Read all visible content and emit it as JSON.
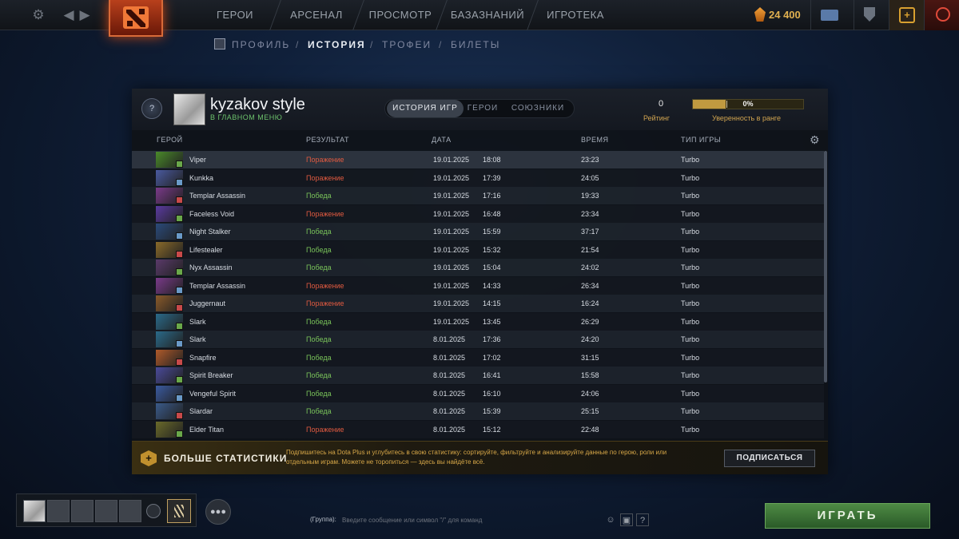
{
  "topbar": {
    "nav": [
      "ГЕРОИ",
      "АРСЕНАЛ",
      "ПРОСМОТР",
      "БАЗАЗНАНИЙ",
      "ИГРОТЕКА"
    ],
    "currency": "24 400"
  },
  "subnav": {
    "items": [
      "ПРОФИЛЬ",
      "ИСТОРИЯ",
      "ТРОФЕИ",
      "БИЛЕТЫ"
    ],
    "active": "ИСТОРИЯ"
  },
  "profile": {
    "rank_badge": "?",
    "name": "kyzakov style",
    "status": "В ГЛАВНОМ МЕНЮ",
    "tabs": [
      "ИСТОРИЯ ИГР",
      "ГЕРОИ",
      "СОЮЗНИКИ"
    ],
    "rating_value": "0",
    "rating_label": "Рейтинг",
    "confidence_value": "0%",
    "confidence_fraction": 0.3,
    "confidence_label": "Уверенность в ранге"
  },
  "table": {
    "columns": [
      "ГЕРОЙ",
      "РЕЗУЛЬТАТ",
      "ДАТА",
      "ВРЕМЯ",
      "ТИП ИГРЫ"
    ],
    "rows": [
      {
        "hero": "Viper",
        "result": "Поражение",
        "date": "19.01.2025",
        "time": "18:08",
        "duration": "23:23",
        "mode": "Turbo"
      },
      {
        "hero": "Kunkka",
        "result": "Поражение",
        "date": "19.01.2025",
        "time": "17:39",
        "duration": "24:05",
        "mode": "Turbo"
      },
      {
        "hero": "Templar Assassin",
        "result": "Победа",
        "date": "19.01.2025",
        "time": "17:16",
        "duration": "19:33",
        "mode": "Turbo"
      },
      {
        "hero": "Faceless Void",
        "result": "Поражение",
        "date": "19.01.2025",
        "time": "16:48",
        "duration": "23:34",
        "mode": "Turbo"
      },
      {
        "hero": "Night Stalker",
        "result": "Победа",
        "date": "19.01.2025",
        "time": "15:59",
        "duration": "37:17",
        "mode": "Turbo"
      },
      {
        "hero": "Lifestealer",
        "result": "Победа",
        "date": "19.01.2025",
        "time": "15:32",
        "duration": "21:54",
        "mode": "Turbo"
      },
      {
        "hero": "Nyx Assassin",
        "result": "Победа",
        "date": "19.01.2025",
        "time": "15:04",
        "duration": "24:02",
        "mode": "Turbo"
      },
      {
        "hero": "Templar Assassin",
        "result": "Поражение",
        "date": "19.01.2025",
        "time": "14:33",
        "duration": "26:34",
        "mode": "Turbo"
      },
      {
        "hero": "Juggernaut",
        "result": "Поражение",
        "date": "19.01.2025",
        "time": "14:15",
        "duration": "16:24",
        "mode": "Turbo"
      },
      {
        "hero": "Slark",
        "result": "Победа",
        "date": "19.01.2025",
        "time": "13:45",
        "duration": "26:29",
        "mode": "Turbo"
      },
      {
        "hero": "Slark",
        "result": "Победа",
        "date": "8.01.2025",
        "time": "17:36",
        "duration": "24:20",
        "mode": "Turbo"
      },
      {
        "hero": "Snapfire",
        "result": "Победа",
        "date": "8.01.2025",
        "time": "17:02",
        "duration": "31:15",
        "mode": "Turbo"
      },
      {
        "hero": "Spirit Breaker",
        "result": "Победа",
        "date": "8.01.2025",
        "time": "16:41",
        "duration": "15:58",
        "mode": "Turbo"
      },
      {
        "hero": "Vengeful Spirit",
        "result": "Победа",
        "date": "8.01.2025",
        "time": "16:10",
        "duration": "24:06",
        "mode": "Turbo"
      },
      {
        "hero": "Slardar",
        "result": "Победа",
        "date": "8.01.2025",
        "time": "15:39",
        "duration": "25:15",
        "mode": "Turbo"
      },
      {
        "hero": "Elder Titan",
        "result": "Поражение",
        "date": "8.01.2025",
        "time": "15:12",
        "duration": "22:48",
        "mode": "Turbo"
      }
    ]
  },
  "promo": {
    "title": "БОЛЬШЕ СТАТИСТИКИ",
    "text": "Подпишитесь на Dota Plus и углубитесь в свою статистику: сортируйте, фильтруйте и анализируйте данные по герою, роли или отдельным играм. Можете не торопиться — здесь вы найдёте всё.",
    "button": "ПОДПИСАТЬСЯ"
  },
  "chat": {
    "group": "(Группа):",
    "placeholder": "Введите сообщение или символ \"/\" для команд",
    "help": "?"
  },
  "play_label": "ИГРАТЬ",
  "colors": {
    "loss": "#e05a40",
    "win": "#7ac45a",
    "accent": "#c09a40",
    "play": "#4e8a44"
  }
}
